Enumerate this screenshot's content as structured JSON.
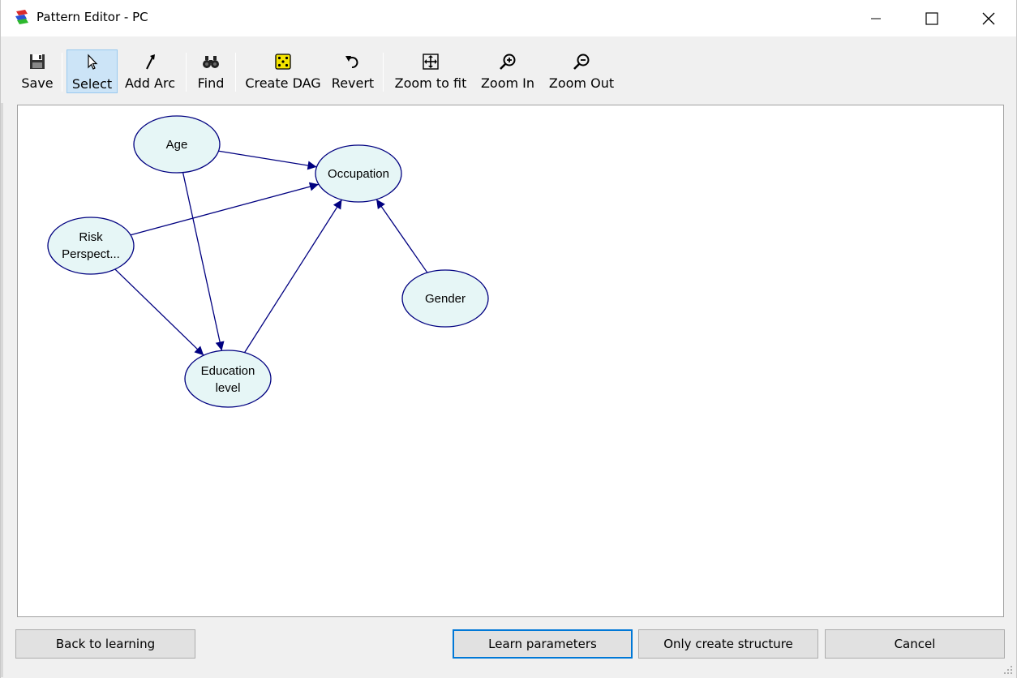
{
  "window": {
    "title": "Pattern Editor - PC"
  },
  "toolbar": {
    "save": "Save",
    "select": "Select",
    "add_arc": "Add Arc",
    "find": "Find",
    "create_dag": "Create DAG",
    "revert": "Revert",
    "zoom_to_fit": "Zoom to fit",
    "zoom_in": "Zoom In",
    "zoom_out": "Zoom Out"
  },
  "graph": {
    "nodes": {
      "age": {
        "label": "Age"
      },
      "occupation": {
        "label": "Occupation"
      },
      "risk": {
        "line1": "Risk",
        "line2": "Perspect..."
      },
      "gender": {
        "label": "Gender"
      },
      "education": {
        "line1": "Education",
        "line2": "level"
      }
    },
    "edges": [
      [
        "age",
        "occupation"
      ],
      [
        "risk",
        "occupation"
      ],
      [
        "age",
        "education"
      ],
      [
        "risk",
        "education"
      ],
      [
        "education",
        "occupation"
      ],
      [
        "gender",
        "occupation"
      ]
    ]
  },
  "buttons": {
    "back_to_learning": "Back to learning",
    "learn_parameters": "Learn parameters",
    "only_create_structure": "Only create structure",
    "cancel": "Cancel"
  },
  "colors": {
    "node_fill": "#e6f6f6",
    "node_stroke": "#000080",
    "edge": "#000080",
    "accent": "#0078d7"
  }
}
